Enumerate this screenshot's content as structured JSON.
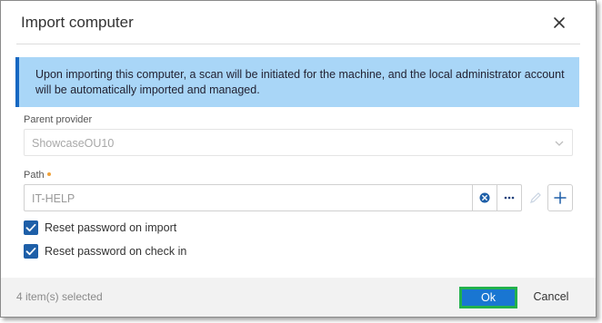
{
  "dialog": {
    "title": "Import computer",
    "close_icon": "close-icon"
  },
  "info_banner": {
    "text": "Upon importing this computer, a scan will be initiated for the machine, and the local administrator account will be automatically imported and managed."
  },
  "parent_provider": {
    "label": "Parent provider",
    "value": "ShowcaseOU10",
    "icon": "chevron-down-icon"
  },
  "path": {
    "label": "Path",
    "value": "IT-HELP",
    "clear_icon": "clear-circle-icon",
    "browse_icon": "ellipsis-icon",
    "edit_icon": "pencil-icon",
    "add_icon": "plus-icon"
  },
  "options": [
    {
      "label": "Reset password on import",
      "checked": true
    },
    {
      "label": "Reset password on check in",
      "checked": true
    }
  ],
  "footer": {
    "selected_count": "4 item(s) selected",
    "ok_label": "Ok",
    "cancel_label": "Cancel"
  },
  "colors": {
    "primary": "#1976d2",
    "banner_bg": "#a9d6f7",
    "banner_accent": "#1668c2",
    "checkbox": "#1e5fa8",
    "highlight_border": "#22b14c",
    "required": "#f0a23a"
  }
}
